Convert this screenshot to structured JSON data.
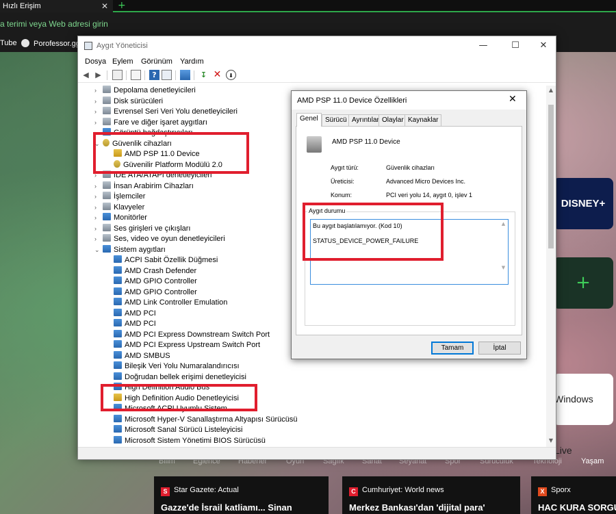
{
  "browser": {
    "tab_title": "Hızlı Erişim",
    "tab_close": "✕",
    "new_tab": "+",
    "address_placeholder": "a terimi veya Web adresi girin",
    "bookmarks": [
      "Tube",
      "Porofessor.gg"
    ]
  },
  "speed_dial": {
    "disney": "DISNEY+",
    "add": "+",
    "windows_live": "Windows Live"
  },
  "news": {
    "categories": [
      "Bilim",
      "Eğlence",
      "Haberler",
      "Oyun",
      "Sağlık",
      "Sanat",
      "Seyahat",
      "Spor",
      "Sürücülük",
      "Teknoloji",
      "Yaşam"
    ],
    "cards": [
      {
        "source": "Star Gazete: Actual",
        "logo": "S",
        "logo_color": "#e01e2e",
        "title": "Gazze'de İsrail katliamı... Sinan"
      },
      {
        "source": "Cumhuriyet: World news",
        "logo": "C",
        "logo_color": "#e01e2e",
        "title": "Merkez Bankası'dan 'dijital para'"
      },
      {
        "source": "Sporx",
        "logo": "X",
        "logo_color": "#e04a1e",
        "title": "HAC KURA SORGU"
      }
    ]
  },
  "device_manager": {
    "title": "Aygıt Yöneticisi",
    "window_buttons": {
      "minimize": "—",
      "maximize": "☐",
      "close": "✕"
    },
    "menu": [
      "Dosya",
      "Eylem",
      "Görünüm",
      "Yardım"
    ],
    "toolbar_icons": [
      "back-icon",
      "forward-icon",
      "properties-icon",
      "update-icon",
      "help-icon",
      "scan-icon",
      "monitor-icon",
      "add-driver-icon",
      "uninstall-icon",
      "disable-icon"
    ],
    "tree": [
      {
        "label": "Depolama denetleyicileri",
        "level": 1,
        "expander": ">",
        "icon": "gen"
      },
      {
        "label": "Disk sürücüleri",
        "level": 1,
        "expander": ">",
        "icon": "gen"
      },
      {
        "label": "Evrensel Seri Veri Yolu denetleyicileri",
        "level": 1,
        "expander": ">",
        "icon": "gen"
      },
      {
        "label": "Fare ve diğer işaret aygıtları",
        "level": 1,
        "expander": ">",
        "icon": "gen"
      },
      {
        "label": "Görüntü bağdaştırıcıları",
        "level": 1,
        "expander": ">",
        "icon": "sys"
      },
      {
        "label": "Güvenlik cihazları",
        "level": 1,
        "expander": "v",
        "icon": "key"
      },
      {
        "label": "AMD PSP 11.0 Device",
        "level": 2,
        "expander": "",
        "icon": "warn"
      },
      {
        "label": "Güvenilir Platform Modülü 2.0",
        "level": 2,
        "expander": "",
        "icon": "key"
      },
      {
        "label": "IDE ATA/ATAPI denetleyicileri",
        "level": 1,
        "expander": ">",
        "icon": "gen"
      },
      {
        "label": "İnsan Arabirim Cihazları",
        "level": 1,
        "expander": ">",
        "icon": "gen"
      },
      {
        "label": "İşlemciler",
        "level": 1,
        "expander": ">",
        "icon": "gen"
      },
      {
        "label": "Klavyeler",
        "level": 1,
        "expander": ">",
        "icon": "gen"
      },
      {
        "label": "Monitörler",
        "level": 1,
        "expander": ">",
        "icon": "sys"
      },
      {
        "label": "Ses girişleri ve çıkışları",
        "level": 1,
        "expander": ">",
        "icon": "gen"
      },
      {
        "label": "Ses, video ve oyun denetleyicileri",
        "level": 1,
        "expander": ">",
        "icon": "gen"
      },
      {
        "label": "Sistem aygıtları",
        "level": 1,
        "expander": "v",
        "icon": "sys"
      },
      {
        "label": "ACPI Sabit Özellik Düğmesi",
        "level": 2,
        "expander": "",
        "icon": "sys"
      },
      {
        "label": "AMD Crash Defender",
        "level": 2,
        "expander": "",
        "icon": "sys"
      },
      {
        "label": "AMD GPIO Controller",
        "level": 2,
        "expander": "",
        "icon": "sys"
      },
      {
        "label": "AMD GPIO Controller",
        "level": 2,
        "expander": "",
        "icon": "sys"
      },
      {
        "label": "AMD Link Controller Emulation",
        "level": 2,
        "expander": "",
        "icon": "sys"
      },
      {
        "label": "AMD PCI",
        "level": 2,
        "expander": "",
        "icon": "sys"
      },
      {
        "label": "AMD PCI",
        "level": 2,
        "expander": "",
        "icon": "sys"
      },
      {
        "label": "AMD PCI Express Downstream Switch Port",
        "level": 2,
        "expander": "",
        "icon": "sys"
      },
      {
        "label": "AMD PCI Express Upstream Switch Port",
        "level": 2,
        "expander": "",
        "icon": "sys"
      },
      {
        "label": "AMD SMBUS",
        "level": 2,
        "expander": "",
        "icon": "sys"
      },
      {
        "label": "Bileşik Veri Yolu Numaralandırıcısı",
        "level": 2,
        "expander": "",
        "icon": "sys"
      },
      {
        "label": "Doğrudan bellek erişimi denetleyicisi",
        "level": 2,
        "expander": "",
        "icon": "sys"
      },
      {
        "label": "High Definition Audio Bus",
        "level": 2,
        "expander": "",
        "icon": "sys"
      },
      {
        "label": "High Definition Audio Denetleyicisi",
        "level": 2,
        "expander": "",
        "icon": "warn"
      },
      {
        "label": "Microsoft ACPI Uyumlu Sistem",
        "level": 2,
        "expander": "",
        "icon": "sys"
      },
      {
        "label": "Microsoft Hyper-V Sanallaştırma Altyapısı Sürücüsü",
        "level": 2,
        "expander": "",
        "icon": "sys"
      },
      {
        "label": "Microsoft Sanal Sürücü Listeleyicisi",
        "level": 2,
        "expander": "",
        "icon": "sys"
      },
      {
        "label": "Microsoft Sistem Yönetimi BIOS Sürücüsü",
        "level": 2,
        "expander": "",
        "icon": "sys"
      }
    ]
  },
  "properties_dialog": {
    "title": "AMD PSP 11.0 Device Özellikleri",
    "close": "✕",
    "tabs": [
      "Genel",
      "Sürücü",
      "Ayrıntılar",
      "Olaylar",
      "Kaynaklar"
    ],
    "active_tab": "Genel",
    "device_name": "AMD PSP 11.0 Device",
    "fields": [
      {
        "label": "Aygıt türü:",
        "value": "Güvenlik cihazları"
      },
      {
        "label": "Üreticisi:",
        "value": "Advanced Micro Devices Inc."
      },
      {
        "label": "Konum:",
        "value": "PCI veri yolu 14, aygıt 0, işlev 1"
      }
    ],
    "status_group_label": "Aygıt durumu",
    "status_lines": [
      "Bu aygıt başlatılamıyor. (Kod 10)",
      "STATUS_DEVICE_POWER_FAILURE"
    ],
    "ok_button": "Tamam",
    "cancel_button": "İptal"
  },
  "colors": {
    "highlight": "#e01e2e",
    "accent": "#0078d7",
    "browser_green": "#2ea84a"
  }
}
